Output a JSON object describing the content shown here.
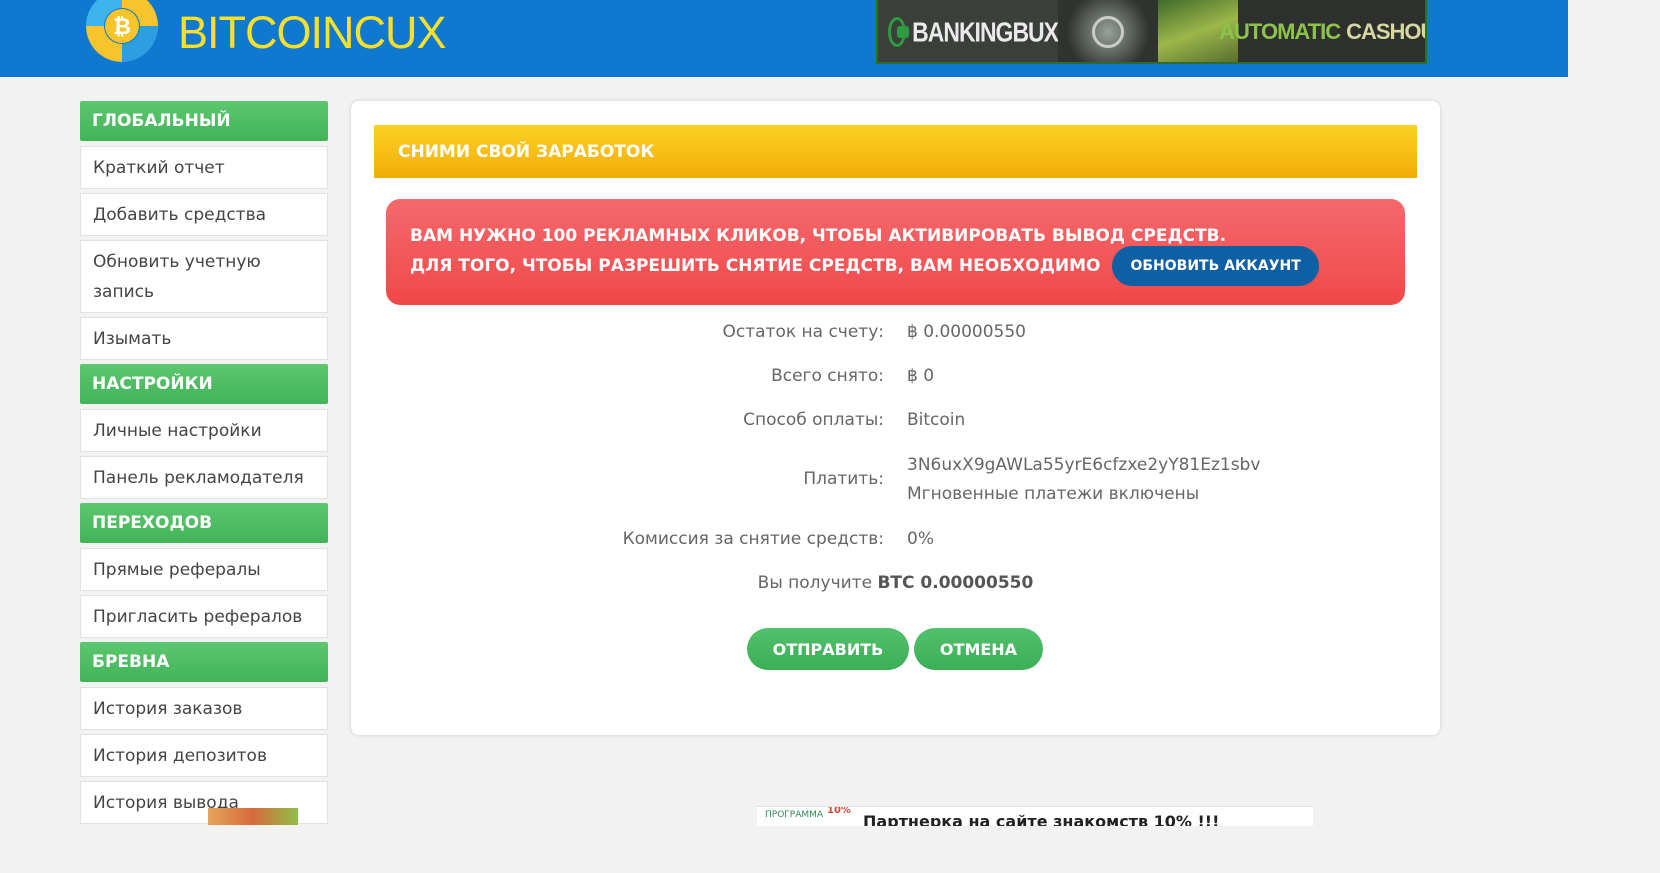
{
  "header": {
    "logo_text": "BITCOINCUX",
    "banner": {
      "brand": "BANKINGBUX",
      "cashout_a": "AUTOMATIC",
      "cashout_b": "CASHOUT"
    }
  },
  "sidebar": {
    "sections": [
      {
        "title": "ГЛОБАЛЬНЫЙ",
        "items": [
          "Краткий отчет",
          "Добавить средства",
          "Обновить учетную запись",
          "Изымать"
        ]
      },
      {
        "title": "НАСТРОЙКИ",
        "items": [
          "Личные настройки",
          "Панель рекламодателя"
        ]
      },
      {
        "title": "ПЕРЕХОДОВ",
        "items": [
          "Прямые рефералы",
          "Пригласить рефералов"
        ]
      },
      {
        "title": "БРЕВНА",
        "items": [
          "История заказов",
          "История депозитов",
          "История вывода"
        ]
      }
    ]
  },
  "main": {
    "title": "СНИМИ СВОЙ ЗАРАБОТОК",
    "alert": {
      "line1": "ВАМ НУЖНО 100 РЕКЛАМНЫХ КЛИКОВ, ЧТОБЫ АКТИВИРОВАТЬ ВЫВОД СРЕДСТВ.",
      "line2": "ДЛЯ ТОГО, ЧТОБЫ РАЗРЕШИТЬ СНЯТИЕ СРЕДСТВ, ВАМ НЕОБХОДИМО",
      "button": "ОБНОВИТЬ АККАУНТ"
    },
    "fields": {
      "balance_label": "Остаток на счету:",
      "balance_value": "฿ 0.00000550",
      "withdrawn_label": "Всего снято:",
      "withdrawn_value": "฿ 0",
      "method_label": "Способ оплаты:",
      "method_value": "Bitcoin",
      "pay_label": "Платить:",
      "pay_address": "3N6uxX9gAWLa55yrE6cfzxe2yY81Ez1sbv",
      "pay_note": "Мгновенные платежи включены",
      "fee_label": "Комиссия за снятие средств:",
      "fee_value": "0%"
    },
    "receive_label": "Вы получите",
    "receive_value": "BTC 0.00000550",
    "submit_label": "ОТПРАВИТЬ",
    "cancel_label": "ОТМЕНА"
  },
  "bottom_ad": {
    "program_label": "ПРОГРАММА",
    "percent": "10%",
    "text": "Партнерка на сайте знакомств 10% !!!"
  },
  "colors": {
    "topbar": "#0f78cf",
    "logo_text": "#f7df2b",
    "sidebar_header": "#4cbb62",
    "card_header": "#f6bd17",
    "alert": "#f25658",
    "upgrade_button": "#0f5fa5",
    "action_button": "#46b761",
    "instant_note": "#22882a"
  }
}
